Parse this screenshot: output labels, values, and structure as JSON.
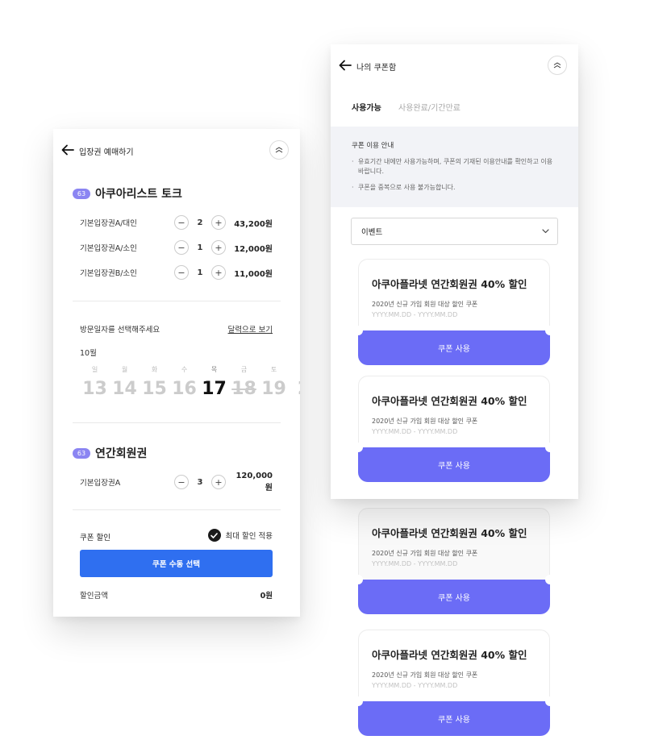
{
  "booking": {
    "header_title": "입장권 예매하기",
    "sections": [
      {
        "badge": "63",
        "title": "아쿠아리스트 토크"
      },
      {
        "badge": "63",
        "title": "연간회원권"
      }
    ],
    "tickets": [
      {
        "name": "기본입장권A/대인",
        "minus": "−",
        "qty": "2",
        "plus": "+",
        "price": "43,200원"
      },
      {
        "name": "기본입장권A/소인",
        "minus": "−",
        "qty": "1",
        "plus": "+",
        "price": "12,000원"
      },
      {
        "name": "기본입장권B/소인",
        "minus": "−",
        "qty": "1",
        "plus": "+",
        "price": "11,000원"
      },
      {
        "name": "기본입장권A",
        "minus": "−",
        "qty": "3",
        "plus": "+",
        "price": "120,000원"
      }
    ],
    "date": {
      "label": "방문일자를 선택해주세요",
      "calendar_link": "달력으로 보기",
      "month": "10월",
      "weekdays": [
        "일",
        "월",
        "화",
        "수",
        "목",
        "금",
        "토"
      ],
      "days": [
        "13",
        "14",
        "15",
        "16",
        "17",
        "18",
        "19",
        "2"
      ],
      "selected_day": "17",
      "unavailable_day": "18"
    },
    "coupon": {
      "label": "쿠폰 할인",
      "max_discount": "최대 할인 적용",
      "manual_button": "쿠폰 수동 선택",
      "discount_label": "할인금액",
      "discount_value": "0원"
    }
  },
  "coupon_box": {
    "header_title": "나의 쿠폰함",
    "tabs": [
      "사용가능",
      "사용완료/기간만료"
    ],
    "notice": {
      "title": "쿠폰 이용 안내",
      "lines": [
        {
          "bullet": "·",
          "text": "유효기간 내에만 사용가능하며, 쿠폰의 기재된 이용안내를 확인하고 이용 바랍니다."
        },
        {
          "bullet": "·",
          "text": "쿠폰을 중복으로 사용 불가능합니다."
        }
      ]
    },
    "filter": {
      "selected": "이벤트"
    },
    "coupons": [
      {
        "title": "아쿠아플라넷 연간회원권 40% 할인",
        "desc": "2020년 신규 가입 회원 대상 할인 쿠폰",
        "period": "YYYY.MM.DD - YYYY.MM.DD",
        "button": "쿠폰 사용"
      },
      {
        "title": "아쿠아플라넷 연간회원권 40% 할인",
        "desc": "2020년 신규 가입 회원 대상 할인 쿠폰",
        "period": "YYYY.MM.DD - YYYY.MM.DD",
        "button": "쿠폰 사용"
      },
      {
        "title": "아쿠아플라넷 연간회원권 40% 할인",
        "desc": "2020년 신규 가입 회원 대상 할인 쿠폰",
        "period": "YYYY.MM.DD - YYYY.MM.DD",
        "button": "쿠폰 사용"
      },
      {
        "title": "아쿠아플라넷 연간회원권 40% 할인",
        "desc": "2020년 신규 가입 회원 대상 할인 쿠폰",
        "period": "YYYY.MM.DD - YYYY.MM.DD",
        "button": "쿠폰 사용"
      }
    ]
  },
  "colors": {
    "primary_blue": "#2f6ff0",
    "coupon_purple": "#6b6cf6",
    "badge_purple": "#8b85f2",
    "notice_bg": "#f2f3f7"
  },
  "icons": [
    "back-arrow-icon",
    "menu-icon",
    "check-icon",
    "chevron-down-icon"
  ]
}
